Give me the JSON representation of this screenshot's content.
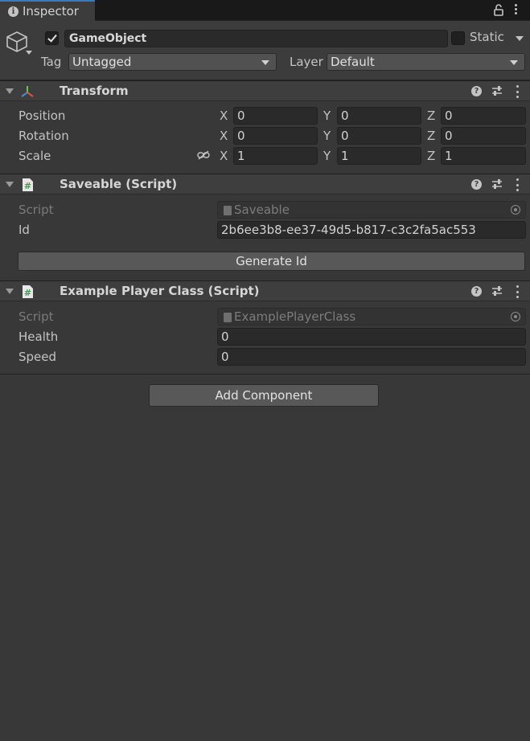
{
  "tab": {
    "title": "Inspector"
  },
  "gameobject": {
    "name": "GameObject",
    "active": true,
    "static_label": "Static",
    "tag_label": "Tag",
    "tag_value": "Untagged",
    "layer_label": "Layer",
    "layer_value": "Default"
  },
  "transform": {
    "title": "Transform",
    "rows": [
      {
        "label": "Position",
        "x": "0",
        "y": "0",
        "z": "0"
      },
      {
        "label": "Rotation",
        "x": "0",
        "y": "0",
        "z": "0"
      },
      {
        "label": "Scale",
        "x": "1",
        "y": "1",
        "z": "1"
      }
    ],
    "axis": {
      "x": "X",
      "y": "Y",
      "z": "Z"
    }
  },
  "saveable": {
    "title": "Saveable (Script)",
    "script_label": "Script",
    "script_value": "Saveable",
    "id_label": "Id",
    "id_value": "2b6ee3b8-ee37-49d5-b817-c3c2fa5ac553",
    "button": "Generate Id"
  },
  "example": {
    "title": "Example Player Class (Script)",
    "script_label": "Script",
    "script_value": "ExamplePlayerClass",
    "health_label": "Health",
    "health_value": "0",
    "speed_label": "Speed",
    "speed_value": "0"
  },
  "add_component": "Add Component",
  "colors": {
    "background": "#383838",
    "tab_accent": "#3a79bb",
    "script_icon": "#3f9b52"
  }
}
